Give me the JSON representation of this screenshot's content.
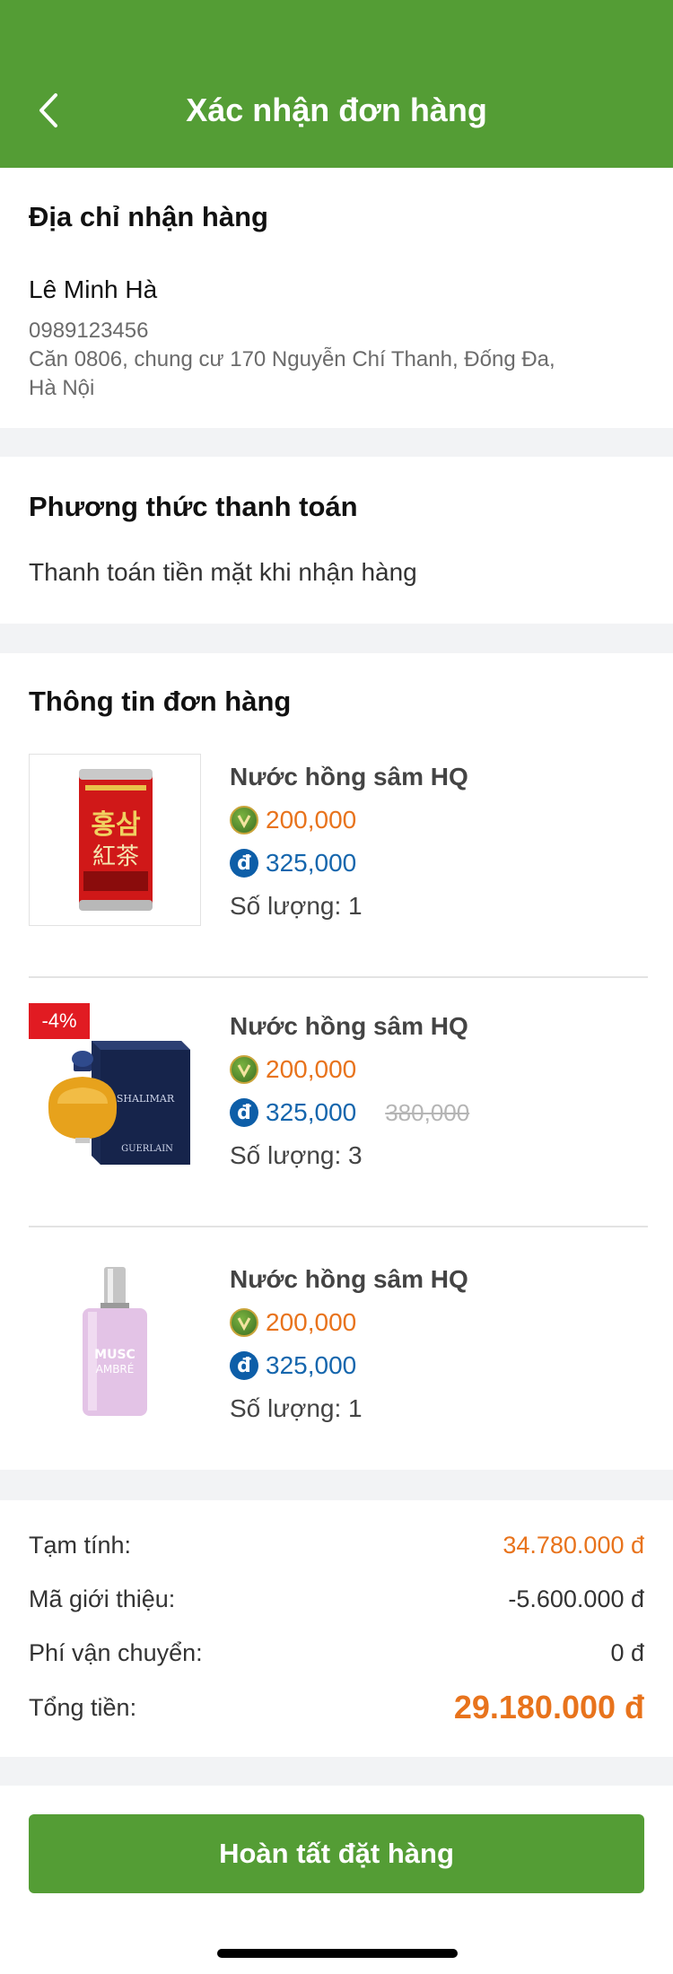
{
  "header": {
    "title": "Xác nhận đơn hàng"
  },
  "address_section": {
    "title": "Địa chỉ nhận hàng",
    "name": "Lê Minh Hà",
    "phone": "0989123456",
    "address": "Căn 0806, chung cư 170 Nguyễn Chí Thanh, Đống Đa, Hà Nội"
  },
  "payment_section": {
    "title": "Phương thức thanh toán",
    "method": "Thanh toán tiền mặt khi nhận hàng"
  },
  "order_section": {
    "title": "Thông tin đơn hàng",
    "items": [
      {
        "name": "Nước hồng sâm HQ",
        "points_price": "200,000",
        "cash_price": "325,000",
        "quantity": "Số lượng: 1"
      },
      {
        "name": "Nước hồng sâm HQ",
        "badge": "-4%",
        "points_price": "200,000",
        "cash_price": "325,000",
        "old_price": "380,000",
        "quantity": "Số lượng: 3"
      },
      {
        "name": "Nước hồng sâm HQ",
        "points_price": "200,000",
        "cash_price": "325,000",
        "quantity": "Số lượng: 1"
      }
    ]
  },
  "summary": {
    "subtotal_label": "Tạm tính:",
    "subtotal_value": "34.780.000 đ",
    "referral_label": "Mã giới thiệu:",
    "referral_value": "-5.600.000 đ",
    "shipping_label": "Phí vận chuyển:",
    "shipping_value": "0 đ",
    "total_label": "Tổng tiền:",
    "total_value": "29.180.000 đ"
  },
  "footer": {
    "button_label": "Hoàn tất đặt hàng"
  },
  "images": {
    "item1_can_text_top": "홍삼",
    "item1_can_text_bottom": "紅茶",
    "item2_box_brand": "SHALIMAR",
    "item2_box_maker": "GUERLAIN",
    "item3_label_line1": "MUSC",
    "item3_label_line2": "AMBRÉ"
  },
  "colors": {
    "brand_green": "#549d35",
    "price_orange": "#e8731c",
    "price_blue": "#1566ad",
    "badge_red": "#e11b22",
    "gap_gray": "#f2f3f5"
  }
}
